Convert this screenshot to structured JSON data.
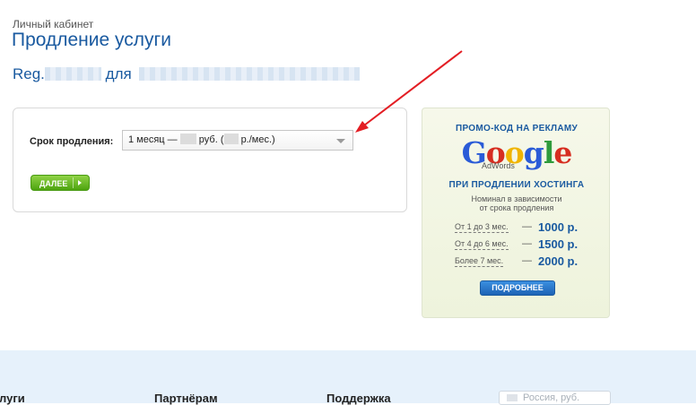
{
  "header": {
    "breadcrumb": "Личный кабинет",
    "title": "Продление услуги",
    "domain_prefix": "Reg.",
    "domain_connector": "для"
  },
  "form": {
    "term_label": "Срок продления:",
    "select": {
      "text_month": "1 месяц —",
      "text_rub": "руб. (",
      "text_per_month": "р./мес.)"
    },
    "next_button": "ДАЛЕЕ"
  },
  "promo": {
    "title": "ПРОМО-КОД НА РЕКЛАМУ",
    "logo": "Google",
    "logo_sub": "AdWords",
    "subtitle": "ПРИ ПРОДЛЕНИИ ХОСТИНГА",
    "note_line1": "Номинал в зависимости",
    "note_line2": "от срока продления",
    "tiers": [
      {
        "label": "От 1 до 3 мес.",
        "dash": "—",
        "amount": "1000 р."
      },
      {
        "label": "От 4 до 6 мес.",
        "dash": "—",
        "amount": "1500 р."
      },
      {
        "label": "Более 7 мес.",
        "dash": "—",
        "amount": "2000 р."
      }
    ],
    "more_button": "ПОДРОБНЕЕ"
  },
  "footer": {
    "columns": [
      "луги",
      "Партнёрам",
      "Поддержка"
    ],
    "currency": "Россия, руб."
  },
  "colors": {
    "title_blue": "#1a5aa0",
    "button_green": "#5cb31c",
    "footer_bg": "#e6f1fb",
    "arrow_red": "#e31e24"
  }
}
